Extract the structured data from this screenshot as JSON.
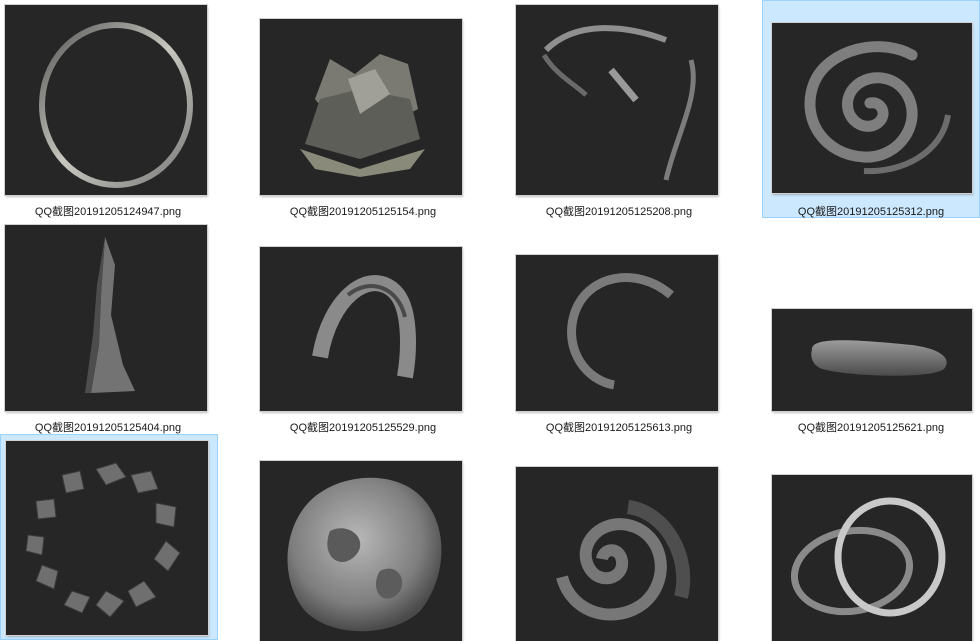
{
  "files": [
    {
      "name": "QQ截图20191205124947.png",
      "selected": false,
      "icon": "ring-render"
    },
    {
      "name": "QQ截图20191205125154.png",
      "selected": false,
      "icon": "crown-render"
    },
    {
      "name": "QQ截图20191205125208.png",
      "selected": false,
      "icon": "twisted-ribbon-render"
    },
    {
      "name": "QQ截图20191205125312.png",
      "selected": true,
      "icon": "spiral-render"
    },
    {
      "name": "QQ截图20191205125404.png",
      "selected": false,
      "icon": "twisted-column-render"
    },
    {
      "name": "QQ截图20191205125529.png",
      "selected": false,
      "icon": "arch-ribbon-render"
    },
    {
      "name": "QQ截图20191205125613.png",
      "selected": false,
      "icon": "curl-ribbon-render"
    },
    {
      "name": "QQ截图20191205125621.png",
      "selected": false,
      "icon": "capsule-render"
    },
    {
      "name": "",
      "selected": true,
      "icon": "rock-ring-render"
    },
    {
      "name": "",
      "selected": false,
      "icon": "lumpy-sphere-render"
    },
    {
      "name": "",
      "selected": false,
      "icon": "spiral-shell-render"
    },
    {
      "name": "",
      "selected": false,
      "icon": "double-ring-render"
    }
  ]
}
